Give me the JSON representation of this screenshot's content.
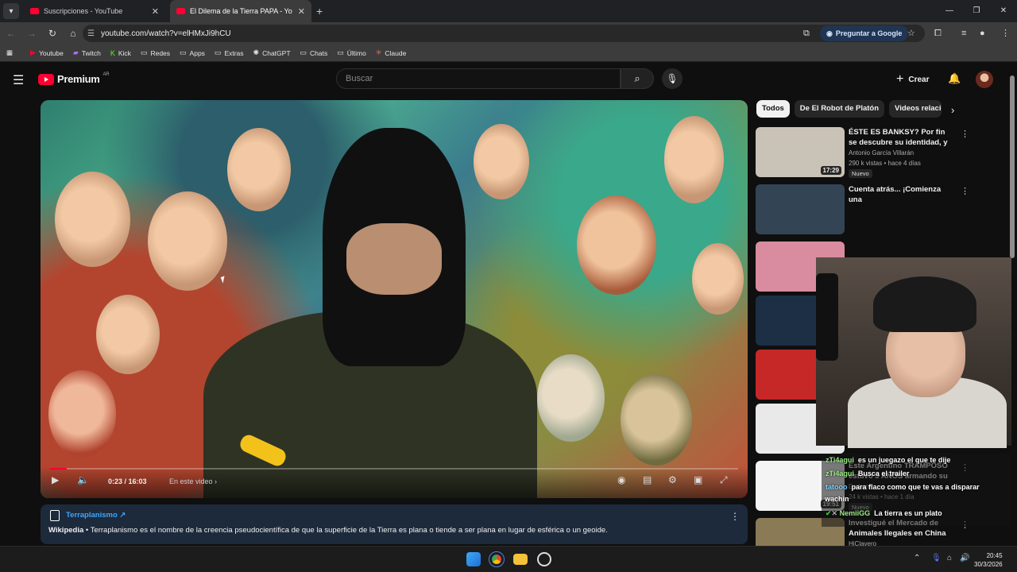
{
  "browser": {
    "tabs": [
      {
        "title": "Suscripciones - YouTube",
        "active": false
      },
      {
        "title": "El Dilema de la Tierra PAPA - Yo",
        "active": true
      }
    ],
    "url": "youtube.com/watch?v=elHMxJi9hCU",
    "ask_google": "Preguntar a Google",
    "bookmarks": [
      "Youtube",
      "Twitch",
      "Kick",
      "Redes",
      "Apps",
      "Extras",
      "ChatGPT",
      "Chats",
      "Último",
      "Claude"
    ]
  },
  "youtube": {
    "logo_text": "Premium",
    "logo_region": "AR",
    "search_placeholder": "Buscar",
    "create_label": "Crear",
    "player": {
      "time": "0:23 / 16:03",
      "chapter": "En este video",
      "progress": 0.024
    },
    "info_card": {
      "title": "Terraplanismo",
      "source": "Wikipedia",
      "text": " • Terraplanismo es el nombre de la creencia pseudocientífica de que la superficie de la Tierra es plana o tiende a ser plana en lugar de esférica o un geoide."
    },
    "chips": [
      "Todos",
      "De El Robot de Platón",
      "Videos relacionados"
    ],
    "recommendations": [
      {
        "title": "ÉSTE ES BANKSY? Por fin se descubre su identidad, y lo ...",
        "channel": "Antonio García Villarán",
        "meta": "290 k vistas • hace 4 días",
        "badge": "Nuevo",
        "duration": "17:29",
        "thumb": "#c9c2b6"
      },
      {
        "title": "Cuenta atrás... ¡Comienza una",
        "channel": "",
        "meta": "",
        "badge": "",
        "duration": "",
        "thumb": "#334455"
      },
      {
        "title": "",
        "channel": "",
        "meta": "",
        "badge": "",
        "duration": "",
        "thumb": "#d98ca0"
      },
      {
        "title": "",
        "channel": "",
        "meta": "",
        "badge": "",
        "duration": "",
        "thumb": "#1d2f45"
      },
      {
        "title": "",
        "channel": "",
        "meta": "",
        "badge": "",
        "duration": "",
        "thumb": "#c62828"
      },
      {
        "title": "",
        "channel": "",
        "meta": "",
        "badge": "",
        "duration": "",
        "thumb": "#e9e9e9"
      },
      {
        "title": "Este Argentino TRAMPOSO estuvo 3 AÑOS armando su ...",
        "channel": "Darkan",
        "meta": "24 k vistas • hace 1 día",
        "badge": "Nuevo",
        "duration": "19:51",
        "thumb": "#f4f4f4"
      },
      {
        "title": "Investigué el Mercado de Animales Ilegales en China",
        "channel": "HiClavero",
        "meta": "",
        "badge": "",
        "duration": "",
        "thumb": "#8a7a55"
      }
    ]
  },
  "stream_chat": [
    {
      "user": "zTi4agui",
      "text": "es un juegazo el que te dije"
    },
    {
      "user": "zTi4agui",
      "text": "Busca el trailer"
    },
    {
      "user": "tatooo",
      "text": "para flaco como que te vas a disparar"
    },
    {
      "user": "",
      "text": "wachin"
    },
    {
      "user": "NemiiGG",
      "text": "La tierra es un plato"
    }
  ],
  "taskbar": {
    "time": "20:45",
    "date": "30/3/2026"
  }
}
